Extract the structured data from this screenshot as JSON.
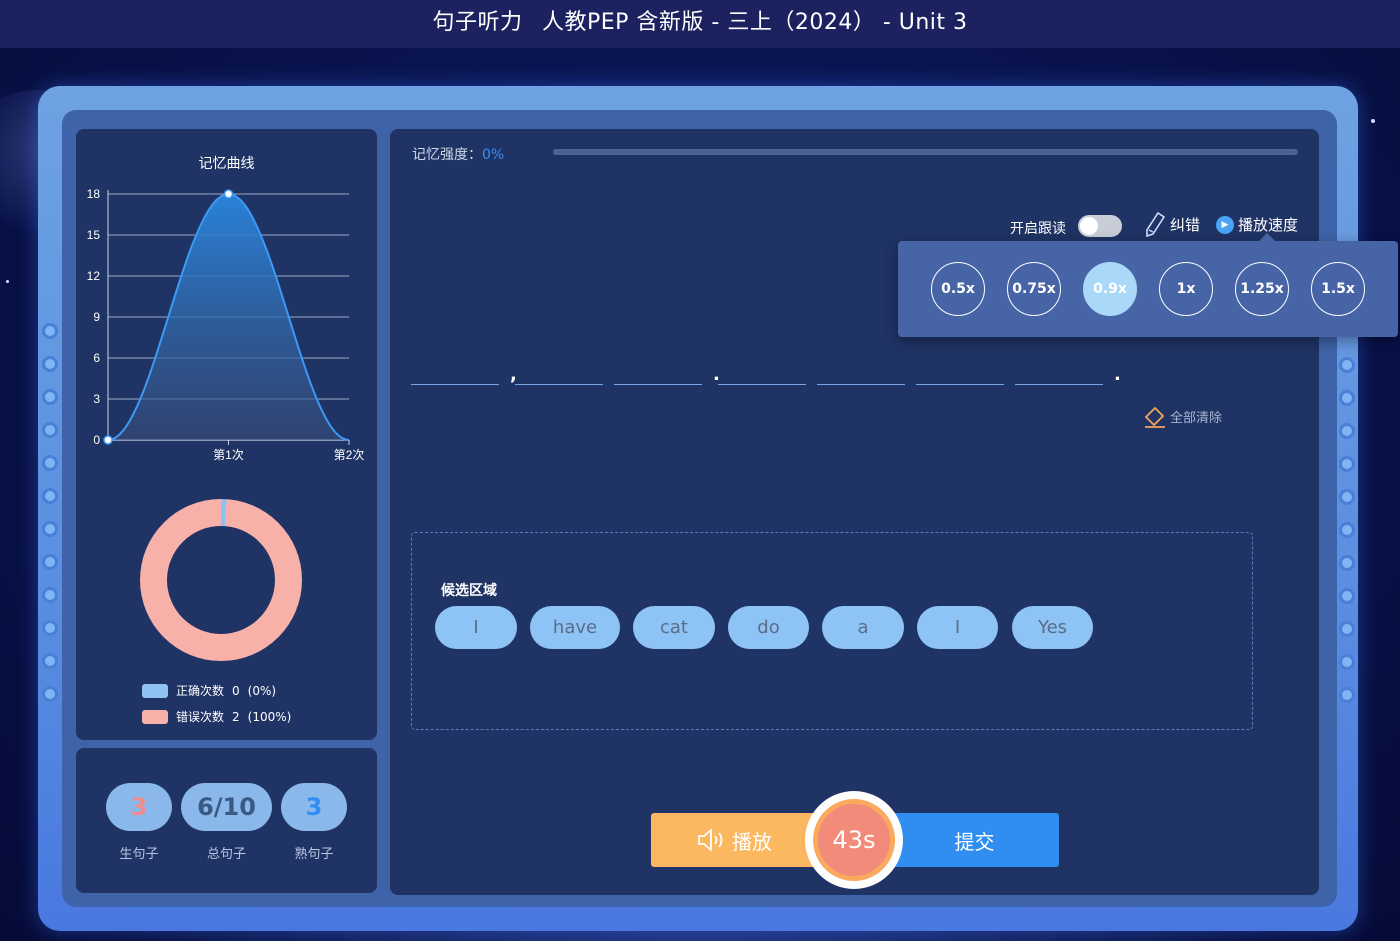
{
  "header": {
    "title": "句子听力",
    "subtitle": "人教PEP 含新版 - 三上（2024） - Unit 3"
  },
  "chart_data": {
    "type": "area",
    "title": "记忆曲线",
    "categories": [
      "第1次",
      "第2次"
    ],
    "y_ticks": [
      "18",
      "15",
      "12",
      "9",
      "6",
      "3",
      "0"
    ],
    "ylim": [
      0,
      18
    ],
    "series": [
      {
        "points": [
          [
            0,
            0
          ],
          [
            1,
            18
          ],
          [
            2,
            0
          ]
        ]
      }
    ],
    "grid": true
  },
  "donut": {
    "correct_label": "正确次数",
    "correct_count": "0",
    "correct_pct": "(0%)",
    "wrong_label": "错误次数",
    "wrong_count": "2",
    "wrong_pct": "(100%)",
    "correct_color": "#8ec2f2",
    "wrong_color": "#f8b1a9",
    "correct_fraction": 0,
    "wrong_fraction": 1
  },
  "stats": {
    "new_value": "3",
    "new_label": "生句子",
    "total_value": "6/10",
    "total_label": "总句子",
    "known_value": "3",
    "known_label": "熟句子"
  },
  "memory": {
    "label": "记忆强度：",
    "value": "0%",
    "progress": 0
  },
  "controls": {
    "follow_label": "开启跟读",
    "follow_on": false,
    "correct_label": "纠错",
    "speed_label": "播放速度"
  },
  "speeds": [
    "0.5x",
    "0.75x",
    "0.9x",
    "1x",
    "1.25x",
    "1.5x"
  ],
  "selected_speed": "0.9x",
  "sentence_punct": [
    ",",
    ".",
    "."
  ],
  "clear_all": "全部清除",
  "candidates": {
    "title": "候选区域",
    "words": [
      "I",
      "have",
      "cat",
      "do",
      "a",
      "I",
      "Yes"
    ]
  },
  "actions": {
    "play": "播放",
    "submit": "提交",
    "timer": "43s"
  },
  "colors": {
    "accent": "#2f8ef0",
    "play": "#fbb860",
    "panel": "#1f3364"
  }
}
